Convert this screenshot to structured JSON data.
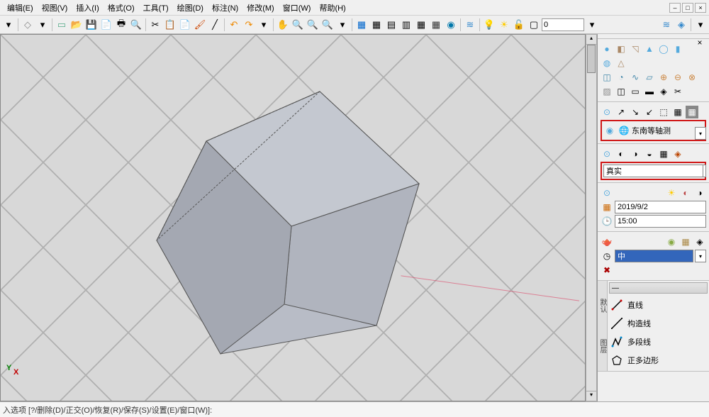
{
  "menu": {
    "items": [
      "编辑(E)",
      "视图(V)",
      "插入(I)",
      "格式(O)",
      "工具(T)",
      "绘图(D)",
      "标注(N)",
      "修改(M)",
      "窗口(W)",
      "帮助(H)"
    ]
  },
  "toolbar": {
    "layer_input": "0"
  },
  "view_panel": {
    "view_name": "东南等轴测",
    "visual_style": "真实",
    "date": "2019/9/2",
    "time": "15:00",
    "lang": "中"
  },
  "draw_panel": {
    "items": [
      {
        "label": "直线",
        "icon": "line"
      },
      {
        "label": "构造线",
        "icon": "xline"
      },
      {
        "label": "多段线",
        "icon": "pline"
      },
      {
        "label": "正多边形",
        "icon": "polygon"
      }
    ]
  },
  "cmdline": {
    "text": "入选项 [?/删除(D)/正交(O)/恢复(R)/保存(S)/设置(E)/窗口(W)]:"
  },
  "axis": {
    "y": "Y",
    "x": "X"
  },
  "side_labels": {
    "a": "默认",
    "b": "图层"
  }
}
